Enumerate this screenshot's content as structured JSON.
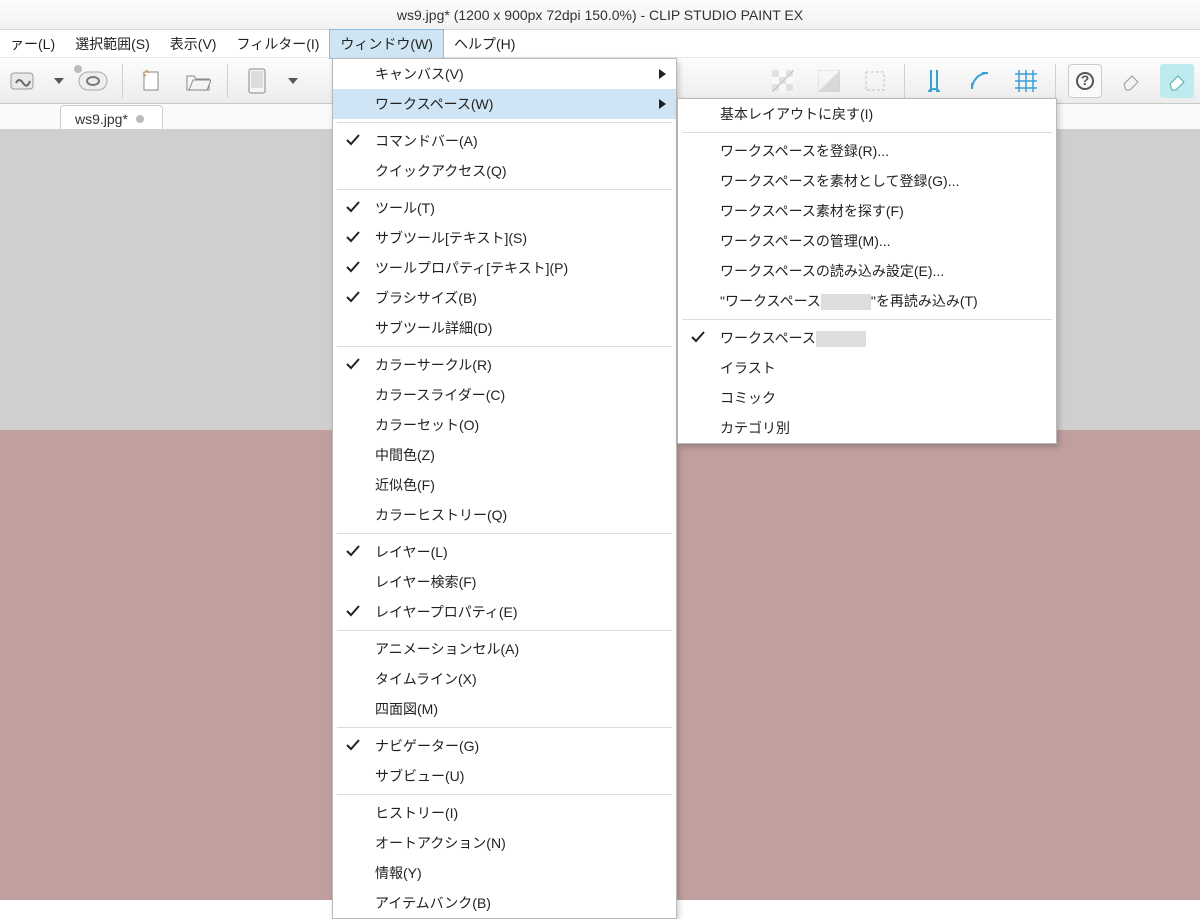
{
  "title": "ws9.jpg* (1200 x 900px 72dpi 150.0%)  - CLIP STUDIO PAINT EX",
  "menubar": {
    "items": [
      "ァー(L)",
      "選択範囲(S)",
      "表示(V)",
      "フィルター(I)",
      "ウィンドウ(W)",
      "ヘルプ(H)"
    ],
    "active_index": 4
  },
  "tab": {
    "label": "ws9.jpg*"
  },
  "window_menu": {
    "items": [
      {
        "label": "キャンバス(V)",
        "arrow": true
      },
      {
        "label": "ワークスペース(W)",
        "arrow": true,
        "highlight": true
      },
      {
        "sep": true
      },
      {
        "label": "コマンドバー(A)",
        "check": true
      },
      {
        "label": "クイックアクセス(Q)"
      },
      {
        "sep": true
      },
      {
        "label": "ツール(T)",
        "check": true
      },
      {
        "label": "サブツール[テキスト](S)",
        "check": true
      },
      {
        "label": "ツールプロパティ[テキスト](P)",
        "check": true
      },
      {
        "label": "ブラシサイズ(B)",
        "check": true
      },
      {
        "label": "サブツール詳細(D)"
      },
      {
        "sep": true
      },
      {
        "label": "カラーサークル(R)",
        "check": true
      },
      {
        "label": "カラースライダー(C)"
      },
      {
        "label": "カラーセット(O)"
      },
      {
        "label": "中間色(Z)"
      },
      {
        "label": "近似色(F)"
      },
      {
        "label": "カラーヒストリー(Q)"
      },
      {
        "sep": true
      },
      {
        "label": "レイヤー(L)",
        "check": true
      },
      {
        "label": "レイヤー検索(F)"
      },
      {
        "label": "レイヤープロパティ(E)",
        "check": true
      },
      {
        "sep": true
      },
      {
        "label": "アニメーションセル(A)"
      },
      {
        "label": "タイムライン(X)"
      },
      {
        "label": "四面図(M)"
      },
      {
        "sep": true
      },
      {
        "label": "ナビゲーター(G)",
        "check": true
      },
      {
        "label": "サブビュー(U)"
      },
      {
        "sep": true
      },
      {
        "label": "ヒストリー(I)"
      },
      {
        "label": "オートアクション(N)"
      },
      {
        "label": "情報(Y)"
      },
      {
        "label": "アイテムバンク(B)"
      }
    ]
  },
  "workspace_submenu": {
    "items": [
      {
        "label": "基本レイアウトに戻す(I)"
      },
      {
        "sep": true
      },
      {
        "label": "ワークスペースを登録(R)..."
      },
      {
        "label": "ワークスペースを素材として登録(G)..."
      },
      {
        "label": "ワークスペース素材を探す(F)"
      },
      {
        "label": "ワークスペースの管理(M)..."
      },
      {
        "label": "ワークスペースの読み込み設定(E)..."
      },
      {
        "label_prefix": "\"ワークスペース",
        "label_suffix": "\"を再読み込み(T)",
        "redacted": true
      },
      {
        "sep": true
      },
      {
        "label_prefix": "ワークスペース",
        "redacted": true,
        "check": true
      },
      {
        "label": "イラスト"
      },
      {
        "label": "コミック"
      },
      {
        "label": "カテゴリ別"
      }
    ]
  },
  "toolbar_icons": [
    "clip-icon",
    "dropdown-icon",
    "swirl-icon",
    "new-file-icon",
    "open-folder-icon",
    "tablet-icon",
    "dropdown-icon",
    "spacer",
    "spacer",
    "spacer",
    "spacer",
    "spacer",
    "spacer",
    "spacer",
    "spacer",
    "spacer",
    "spacer",
    "spacer",
    "spacer",
    "transparency-icon",
    "mask-icon",
    "selection-border-icon",
    "sep",
    "ruler-vert-icon",
    "ruler-curve-icon",
    "grid-icon",
    "sep",
    "help-icon",
    "eraser1-icon",
    "eraser2-icon"
  ]
}
